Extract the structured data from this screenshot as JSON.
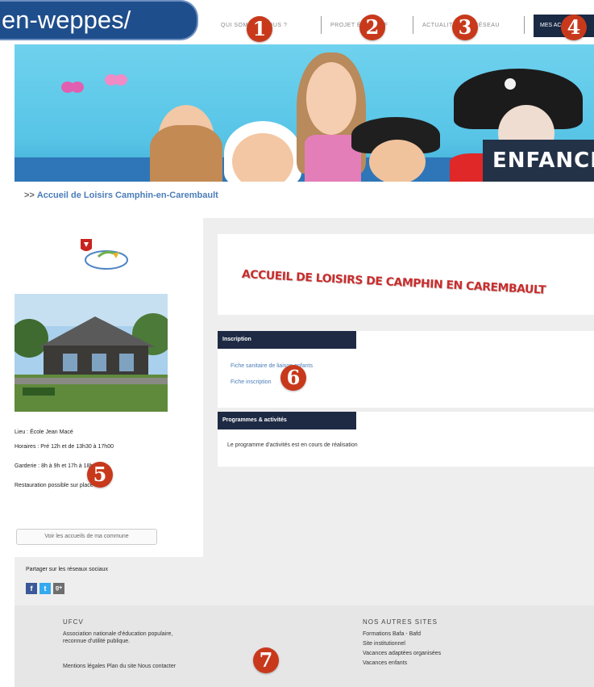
{
  "url_fragment": "en-weppes/",
  "nav": {
    "item1": "QUI SOMMES-NOUS ?",
    "item2": "PROJET ÉDUCATIF",
    "item3": "ACTUALITÉS DU RÉSEAU",
    "item4": "MES ACCUEILS"
  },
  "badges": [
    "1",
    "2",
    "3",
    "4",
    "5",
    "6",
    "7"
  ],
  "banner": {
    "label": "ENFANCE"
  },
  "breadcrumb": {
    "arrows": ">>",
    "text": "Accueil de Loisirs Camphin-en-Carembault"
  },
  "center": {
    "lieu": "Lieu : École Jean Macé",
    "horaires": "Horaires : Pré 12h et de 13h30 à 17h00",
    "garderie": "Garderie : 8h à 9h et 17h à 18h",
    "restauration": "Restauration possible sur place",
    "communes_button": "Voir les accueils de ma commune"
  },
  "main": {
    "title": "ACCUEIL DE LOISIRS DE CAMPHIN EN CAREMBAULT",
    "inscription": {
      "heading": "Inscription",
      "link1": "Fiche sanitaire de liaison enfants",
      "link2": "Fiche inscription"
    },
    "programmes": {
      "heading": "Programmes & activités",
      "text": "Le programme d'activités est en cours de réalisation"
    }
  },
  "share": {
    "label": "Partager sur les réseaux sociaux",
    "fb": "f",
    "tw": "t",
    "gp": "g+"
  },
  "footer": {
    "left_title": "UFCV",
    "left_line1": "Association nationale d'éducation populaire,",
    "left_line2": "reconnue d'utilité publique.",
    "links": "Mentions légales   Plan du site   Nous contacter",
    "right_title": "NOS AUTRES SITES",
    "sites": [
      "Formations Bafa - Bafd",
      "Site institutionnel",
      "Vacances adaptées organisées",
      "Vacances enfants"
    ]
  },
  "colors": {
    "accent_navy": "#1e2a44",
    "badge_red": "#c8391c",
    "link_blue": "#4b7db8",
    "title_red": "#c82d2d"
  }
}
